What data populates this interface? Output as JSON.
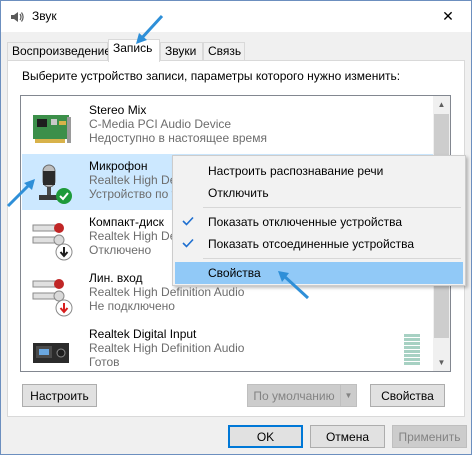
{
  "window": {
    "title": "Звук",
    "close_glyph": "✕"
  },
  "tabs": [
    {
      "label": "Воспроизведение",
      "active": false
    },
    {
      "label": "Запись",
      "active": true
    },
    {
      "label": "Звуки",
      "active": false
    },
    {
      "label": "Связь",
      "active": false
    }
  ],
  "panel": {
    "instruction": "Выберите устройство записи, параметры которого нужно изменить:"
  },
  "devices": [
    {
      "name": "Stereo Mix",
      "driver": "C-Media PCI Audio Device",
      "status": "Недоступно в настоящее время",
      "icon": "sound-card-icon",
      "selected": false
    },
    {
      "name": "Микрофон",
      "driver": "Realtek High Definition Audio",
      "status": "Устройство по умолчанию",
      "icon": "microphone-icon",
      "selected": true,
      "badge": "default-check-icon"
    },
    {
      "name": "Компакт-диск",
      "driver": "Realtek High Definition Audio",
      "status": "Отключено",
      "icon": "rca-jack-icon",
      "selected": false,
      "badge": "disabled-down-arrow-icon"
    },
    {
      "name": "Лин. вход",
      "driver": "Realtek High Definition Audio",
      "status": "Не подключено",
      "icon": "rca-jack-icon",
      "selected": false,
      "badge": "unplugged-down-arrow-icon"
    },
    {
      "name": "Realtek Digital Input",
      "driver": "Realtek High Definition Audio",
      "status": "Готов",
      "icon": "digital-input-icon",
      "selected": false
    }
  ],
  "context_menu": {
    "items": [
      {
        "label": "Настроить распознавание речи",
        "checked": false,
        "highlighted": false
      },
      {
        "label": "Отключить",
        "checked": false,
        "highlighted": false
      },
      {
        "label": "Показать отключенные устройства",
        "checked": true,
        "highlighted": false
      },
      {
        "label": "Показать отсоединенные устройства",
        "checked": true,
        "highlighted": false
      },
      {
        "label": "Свойства",
        "checked": false,
        "highlighted": true
      }
    ]
  },
  "panel_buttons": {
    "configure": "Настроить",
    "set_default": "По умолчанию",
    "properties": "Свойства"
  },
  "dialog_buttons": {
    "ok": "OK",
    "cancel": "Отмена",
    "apply": "Применить"
  },
  "colors": {
    "selection": "#cce8ff",
    "menu_highlight": "#91c9f7",
    "annotation_arrow": "#2e8fd8",
    "check_green": "#1e9a3a",
    "badge_red": "#d81e1e"
  }
}
